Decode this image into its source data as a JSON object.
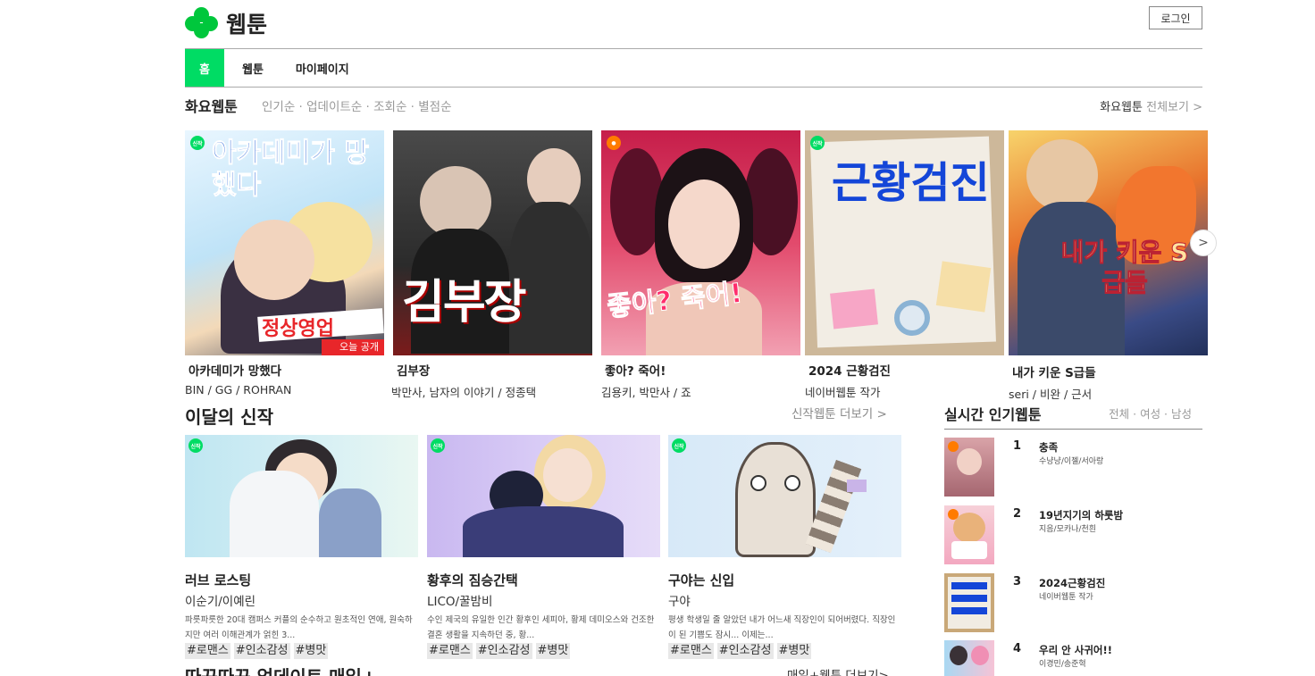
{
  "header": {
    "logo_text": "웹툰",
    "login_label": "로그인"
  },
  "nav": {
    "items": [
      {
        "label": "홈",
        "active": true
      },
      {
        "label": "웹툰",
        "active": false
      },
      {
        "label": "마이페이지",
        "active": false
      }
    ]
  },
  "daily": {
    "title": "화요웹툰",
    "sort_options": "인기순 · 업데이트순 · 조회순 · 별점순",
    "view_all_prefix": "화요웹툰",
    "view_all_label": "전체보기 >",
    "items": [
      {
        "title": "아카데미가 망했다",
        "author": "BIN / GG / ROHRAN",
        "badge": "신작",
        "cover_text": "아카데미가 망했다",
        "cover_sub": "정상영업",
        "cover_note": "오늘 공개"
      },
      {
        "title": "김부장",
        "author": "박만사, 남자의 이야기 / 정종택",
        "cover_text": "김부장"
      },
      {
        "title": "좋아? 죽어!",
        "author": "김용키, 박만사 / 죠",
        "cover_text": "좋아? 죽어!"
      },
      {
        "title": "2024 근황검진",
        "author": "네이버웹툰 작가",
        "badge": "신작",
        "cover_text": "근황검진"
      },
      {
        "title": "내가 키운 S급들",
        "author": "seri / 비완 / 근서",
        "cover_text": "내가 키운 S급들"
      }
    ],
    "next_arrow": ">"
  },
  "new_series": {
    "title": "이달의 신작",
    "more_label": "신작웹툰 더보기 >",
    "items": [
      {
        "title": "러브 로스팅",
        "author": "이순기/이예린",
        "description": "파릇파릇한 20대 캠퍼스 커플의 순수하고 원초적인 연애, 원숙하지만 여러 이해관계가 얽힌 3...",
        "tags": [
          "#로맨스",
          "#인소감성",
          "#병맛"
        ],
        "badge": "신작"
      },
      {
        "title": "황후의 짐승간택",
        "author": "LICO/꿀밤비",
        "description": "수인 제국의 유일한 인간 황후인 세피아, 황제 데미오스와 건조한 결혼 생활을 지속하던 중, 황...",
        "tags": [
          "#로맨스",
          "#인소감성",
          "#병맛"
        ],
        "badge": "신작"
      },
      {
        "title": "구야는 신입",
        "author": "구야",
        "description": "평생 학생일 줄 알았던 내가 어느새 직장인이 되어버렸다. 직장인이 된 기쁨도 잠시... 이제는...",
        "tags": [
          "#로맨스",
          "#인소감성",
          "#병맛"
        ],
        "badge": "신작"
      }
    ]
  },
  "update_section": {
    "title": "따끈따끈 업데이트 매일+",
    "more_label": "매일+웹툰 더보기>"
  },
  "ranking": {
    "title": "실시간 인기웹툰",
    "filter": "전체 · 여성 · 남성",
    "items": [
      {
        "rank": "1",
        "title": "충족",
        "author": "수냥냥/이젤/서아랑"
      },
      {
        "rank": "2",
        "title": "19년지기의 하룻밤",
        "author": "지음/모카나/천흰"
      },
      {
        "rank": "3",
        "title": "2024근황검진",
        "author": "네이버웹툰 작가"
      },
      {
        "rank": "4",
        "title": "우리 안 사귀어!!",
        "author": "이경민/송준혁"
      }
    ]
  },
  "colors": {
    "brand_green": "#00dc64",
    "logo_green": "#00c73c"
  }
}
